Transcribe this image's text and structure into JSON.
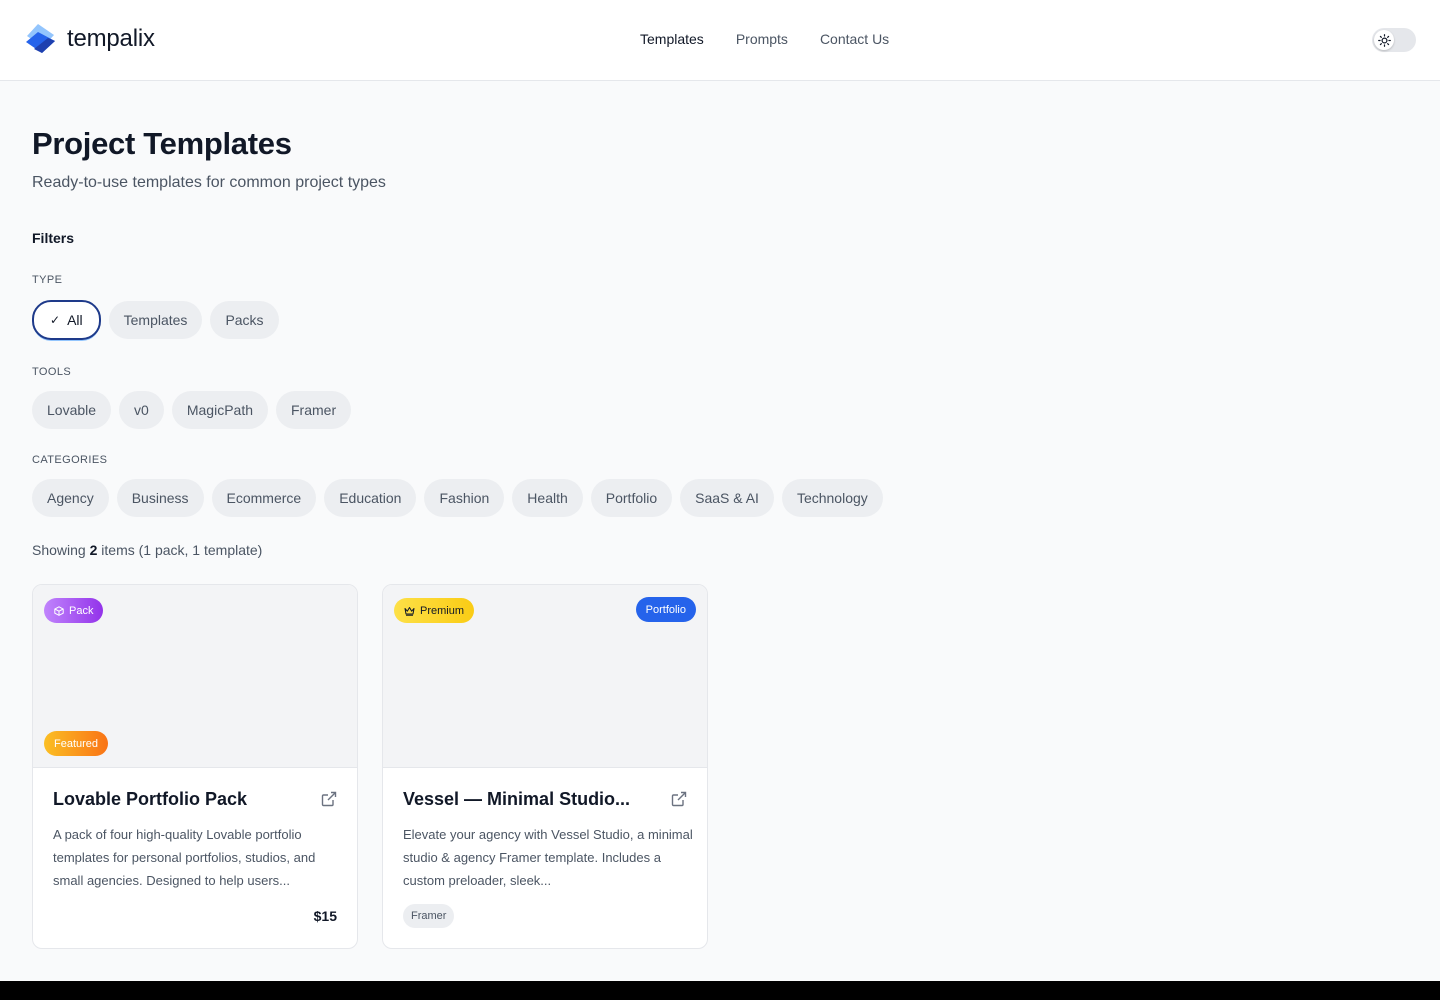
{
  "brand": {
    "name": "tempalix"
  },
  "nav": {
    "items": [
      {
        "label": "Templates",
        "active": true
      },
      {
        "label": "Prompts",
        "active": false
      },
      {
        "label": "Contact Us",
        "active": false
      }
    ]
  },
  "theme_toggle": {
    "icon": "sun-icon",
    "mode": "light"
  },
  "header": {
    "title": "Project Templates",
    "subtitle": "Ready-to-use templates for common project types"
  },
  "filters": {
    "heading": "Filters",
    "type": {
      "label": "TYPE",
      "options": [
        {
          "label": "All",
          "selected": true
        },
        {
          "label": "Templates",
          "selected": false
        },
        {
          "label": "Packs",
          "selected": false
        }
      ]
    },
    "tools": {
      "label": "TOOLS",
      "options": [
        {
          "label": "Lovable"
        },
        {
          "label": "v0"
        },
        {
          "label": "MagicPath"
        },
        {
          "label": "Framer"
        }
      ]
    },
    "categories": {
      "label": "CATEGORIES",
      "options": [
        {
          "label": "Agency"
        },
        {
          "label": "Business"
        },
        {
          "label": "Ecommerce"
        },
        {
          "label": "Education"
        },
        {
          "label": "Fashion"
        },
        {
          "label": "Health"
        },
        {
          "label": "Portfolio"
        },
        {
          "label": "SaaS & AI"
        },
        {
          "label": "Technology"
        }
      ]
    }
  },
  "results": {
    "prefix": "Showing",
    "count": "2",
    "suffix": "items (1 pack, 1 template)"
  },
  "cards": [
    {
      "title": "Lovable Portfolio Pack",
      "description": "A pack of four high-quality Lovable portfolio templates for personal portfolios, studios, and small agencies. Designed to help users...",
      "badge_top": "Pack",
      "badge_bottom": "Featured",
      "price": "$15"
    },
    {
      "title": "Vessel — Minimal Studio...",
      "description": "Elevate your agency with Vessel Studio, a minimal studio & agency Framer template. Includes a custom preloader, sleek...",
      "badge_top": "Premium",
      "badge_category": "Portfolio",
      "tool": "Framer"
    }
  ],
  "colors": {
    "accent": "#2563eb",
    "selected_border": "#1e3a8a",
    "pack_badge": "#a855f7",
    "featured_badge": "#f59e0b",
    "premium_badge": "#facc15"
  }
}
